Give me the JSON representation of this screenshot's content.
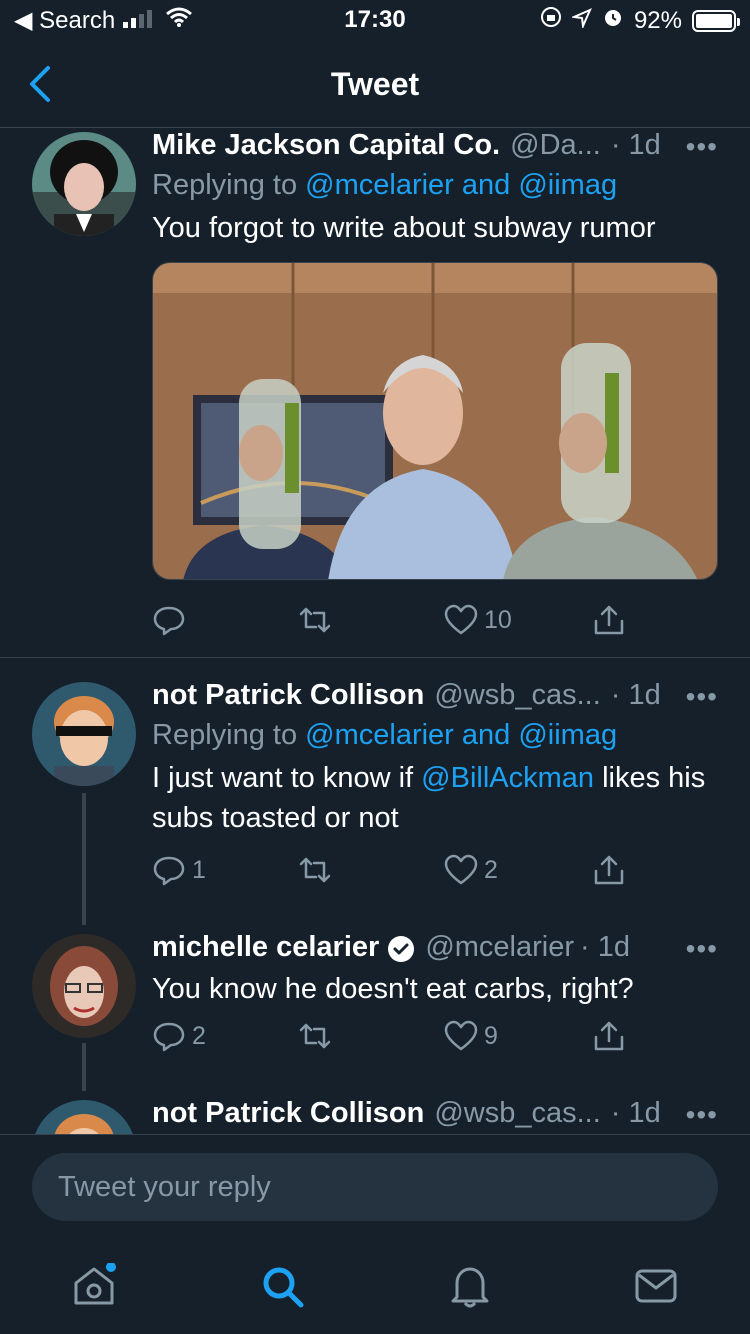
{
  "status_bar": {
    "back_app": "◀ Search",
    "time": "17:30",
    "battery": "92%"
  },
  "header": {
    "title": "Tweet"
  },
  "tweets": [
    {
      "name": "Mike Jackson Capital Co.",
      "handle": "@Da...",
      "time": "· 1d",
      "reply_prefix": "Replying to ",
      "reply_targets": "@mcelarier and @iimag",
      "text": "You forgot to write about subway rumor",
      "counts": {
        "reply": "",
        "retweet": "",
        "like": "10"
      }
    },
    {
      "name": "not Patrick Collison",
      "handle": "@wsb_cas...",
      "time": "· 1d",
      "reply_prefix": "Replying to ",
      "reply_targets": "@mcelarier and @iimag",
      "text_before": "I just want to know if ",
      "mention": "@BillAckman",
      "text_after": " likes his subs toasted or not",
      "counts": {
        "reply": "1",
        "retweet": "",
        "like": "2"
      }
    },
    {
      "name": "michelle celarier",
      "handle": "@mcelarier",
      "time": "· 1d",
      "verified": true,
      "text": "You know he doesn't eat carbs, right?",
      "counts": {
        "reply": "2",
        "retweet": "",
        "like": "9"
      }
    },
    {
      "name": "not Patrick Collison",
      "handle": "@wsb_cas...",
      "time": "· 1d"
    }
  ],
  "composer": {
    "placeholder": "Tweet your reply"
  },
  "tabs": [
    "home-icon",
    "search-icon",
    "notifications-icon",
    "messages-icon"
  ],
  "colors": {
    "background": "#15202b",
    "accent": "#1da1f2",
    "secondary_text": "#8899a6",
    "divider": "#38444d"
  }
}
